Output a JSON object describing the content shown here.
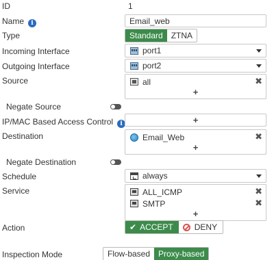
{
  "labels": {
    "id": "ID",
    "name": "Name",
    "type": "Type",
    "incoming": "Incoming Interface",
    "outgoing": "Outgoing Interface",
    "source": "Source",
    "negate_source": "Negate Source",
    "ipmac": "IP/MAC Based Access Control",
    "destination": "Destination",
    "negate_destination": "Negate Destination",
    "schedule": "Schedule",
    "service": "Service",
    "action": "Action",
    "inspection_mode": "Inspection Mode"
  },
  "values": {
    "id": "1",
    "name": "Email_web",
    "type_options": [
      "Standard",
      "ZTNA"
    ],
    "type_selected": "Standard",
    "incoming_interface": "port1",
    "outgoing_interface": "port2",
    "source": [
      "all"
    ],
    "negate_source": false,
    "ipmac": [],
    "destination": [
      "Email_Web"
    ],
    "negate_destination": false,
    "schedule": "always",
    "service": [
      "ALL_ICMP",
      "SMTP"
    ],
    "action_options": [
      "ACCEPT",
      "DENY"
    ],
    "action_selected": "ACCEPT",
    "inspection_options": [
      "Flow-based",
      "Proxy-based"
    ],
    "inspection_selected": "Proxy-based"
  },
  "symbols": {
    "add": "+",
    "remove": "✖",
    "info": "i",
    "check": "✔"
  },
  "colors": {
    "accent_green": "#3c8b4b",
    "info_blue": "#2a6bbf",
    "deny_red": "#d9534f"
  }
}
